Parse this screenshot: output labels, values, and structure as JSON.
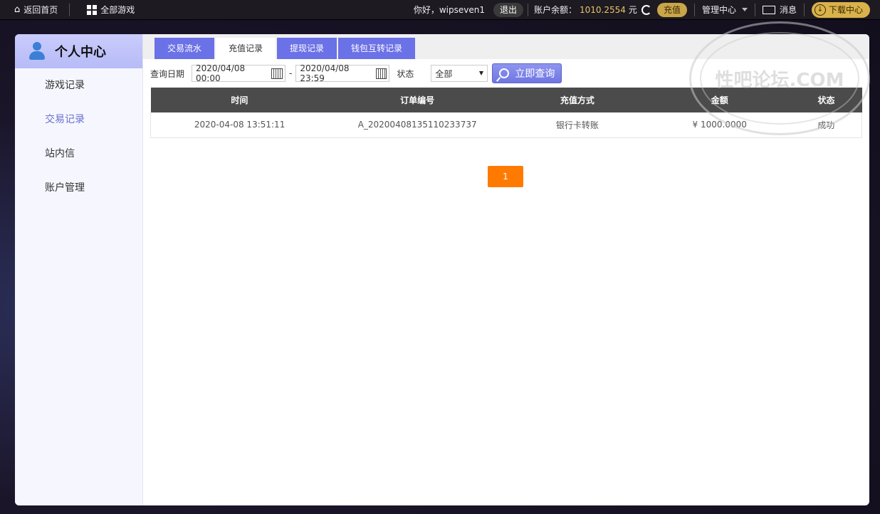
{
  "topbar": {
    "home_label": "返回首页",
    "games_label": "全部游戏",
    "greeting": "你好，wipseven1",
    "logout_label": "退出",
    "balance_label": "账户余额：",
    "balance_value": "1010.2554",
    "balance_unit": "元",
    "recharge_label": "充值",
    "manage_label": "管理中心",
    "message_label": "消息",
    "download_label": "下载中心"
  },
  "sidebar": {
    "title": "个人中心",
    "items": [
      {
        "label": "游戏记录"
      },
      {
        "label": "交易记录"
      },
      {
        "label": "站内信"
      },
      {
        "label": "账户管理"
      }
    ]
  },
  "tabs": [
    {
      "label": "交易流水"
    },
    {
      "label": "充值记录"
    },
    {
      "label": "提现记录"
    },
    {
      "label": "钱包互转记录"
    }
  ],
  "filter": {
    "date_label": "查询日期",
    "start_date": "2020/04/08 00:00",
    "end_date": "2020/04/08 23:59",
    "status_label": "状态",
    "status_value": "全部",
    "search_label": "立即查询"
  },
  "table": {
    "headers": [
      "时间",
      "订单编号",
      "充值方式",
      "金额",
      "状态"
    ],
    "rows": [
      [
        "2020-04-08 13:51:11",
        "A_20200408135110233737",
        "银行卡转账",
        "¥ 1000.0000",
        "成功"
      ]
    ]
  },
  "pagination": {
    "current": "1"
  },
  "watermark": {
    "text": "性吧论坛.COM"
  },
  "colors": {
    "accent": "#6b71e6",
    "pager": "#ff7a00",
    "balance": "#e9c46a"
  }
}
